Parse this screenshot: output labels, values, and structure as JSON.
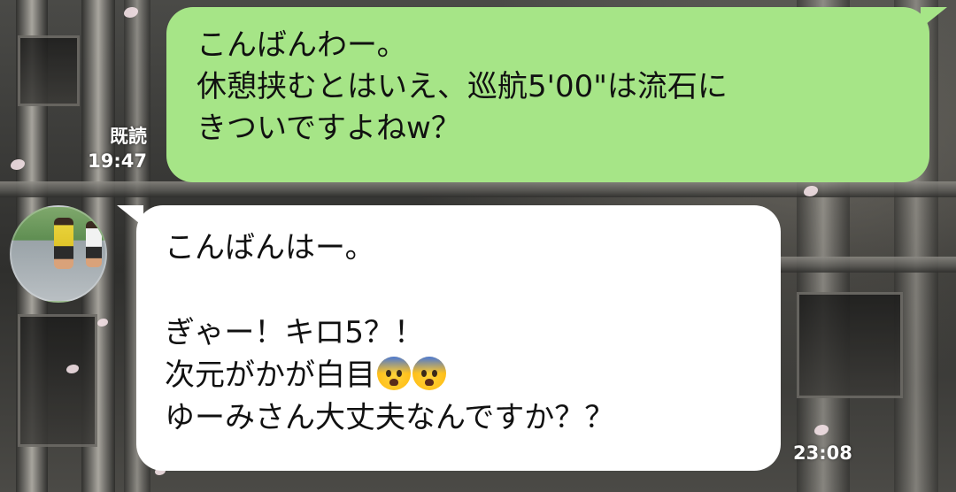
{
  "chat": {
    "outgoing": {
      "lines": [
        "こんばんわー。",
        "休憩挟むとはいえ、巡航5'00\"は流石に",
        "きついですよねw？"
      ],
      "read_label": "既読",
      "time": "19:47",
      "bubble_color": "#a6e587"
    },
    "incoming": {
      "lines": [
        "こんばんはー。",
        "ぎゃー！キロ5？！",
        "次元がかが白目",
        "ゆーみさん大丈夫なんですか？？"
      ],
      "emoji": [
        "anxious-face-with-sweat",
        "anxious-face-with-sweat"
      ],
      "time": "23:08",
      "bubble_color": "#ffffff",
      "avatar_icon": "runner-photo-avatar"
    }
  }
}
